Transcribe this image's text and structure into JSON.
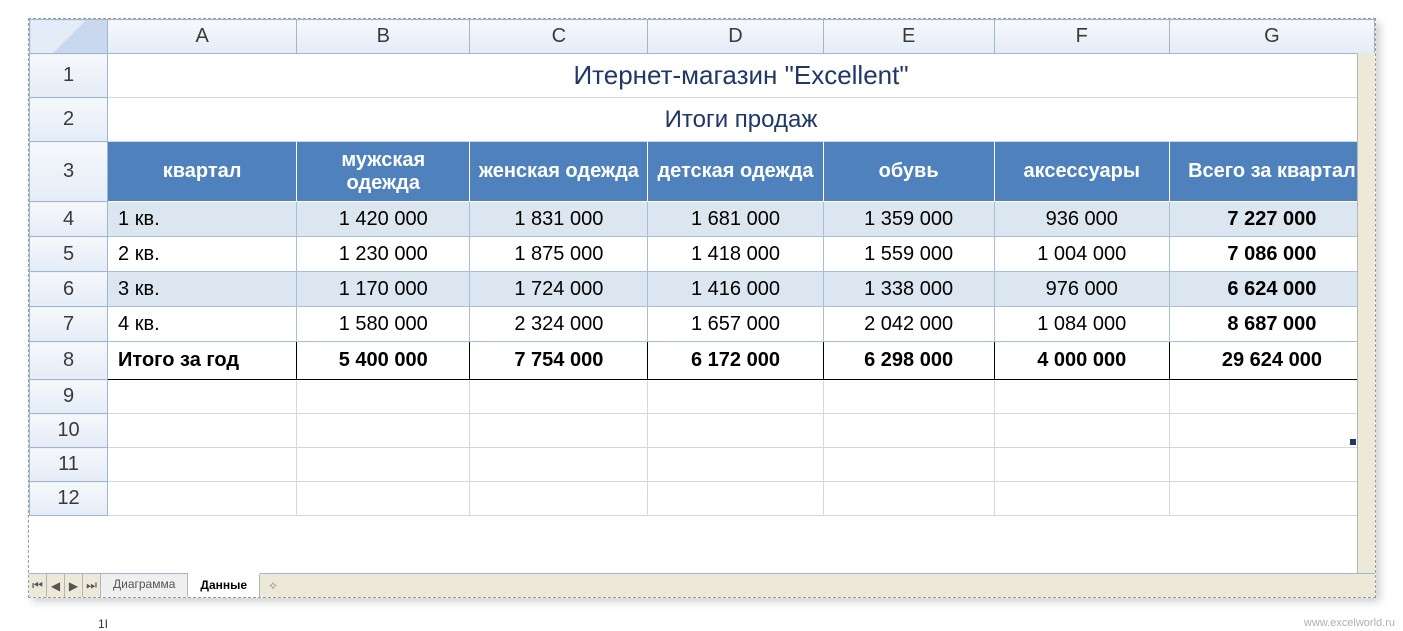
{
  "columns": [
    "A",
    "B",
    "C",
    "D",
    "E",
    "F",
    "G"
  ],
  "row_numbers": [
    "1",
    "2",
    "3",
    "4",
    "5",
    "6",
    "7",
    "8",
    "9",
    "10",
    "11",
    "12"
  ],
  "title1": "Итернет-магазин \"Excellent\"",
  "title2": "Итоги продаж",
  "headers": {
    "quarter": "квартал",
    "mens": "мужская одежда",
    "womens": "женская одежда",
    "kids": "детская одежда",
    "shoes": "обувь",
    "accessories": "аксессуары",
    "total_q": "Всего за квартал"
  },
  "rows": [
    {
      "label": "1 кв.",
      "mens": "1 420 000",
      "womens": "1 831 000",
      "kids": "1 681 000",
      "shoes": "1 359 000",
      "accessories": "936 000",
      "total": "7 227 000"
    },
    {
      "label": "2 кв.",
      "mens": "1 230 000",
      "womens": "1 875 000",
      "kids": "1 418 000",
      "shoes": "1 559 000",
      "accessories": "1 004 000",
      "total": "7 086 000"
    },
    {
      "label": "3 кв.",
      "mens": "1 170 000",
      "womens": "1 724 000",
      "kids": "1 416 000",
      "shoes": "1 338 000",
      "accessories": "976 000",
      "total": "6 624 000"
    },
    {
      "label": "4 кв.",
      "mens": "1 580 000",
      "womens": "2 324 000",
      "kids": "1 657 000",
      "shoes": "2 042 000",
      "accessories": "1 084 000",
      "total": "8 687 000"
    }
  ],
  "totals": {
    "label": "Итого за год",
    "mens": "5 400 000",
    "womens": "7 754 000",
    "kids": "6 172 000",
    "shoes": "6 298 000",
    "accessories": "4 000 000",
    "grand": "29 624 000"
  },
  "tabs": {
    "chart": "Диаграмма",
    "data": "Данные"
  },
  "nav": {
    "first": "⏮",
    "prev": "◀",
    "next": "▶",
    "last": "⏭",
    "new": "✧"
  },
  "watermark": "www.excelworld.ru",
  "pagemark": "1I"
}
